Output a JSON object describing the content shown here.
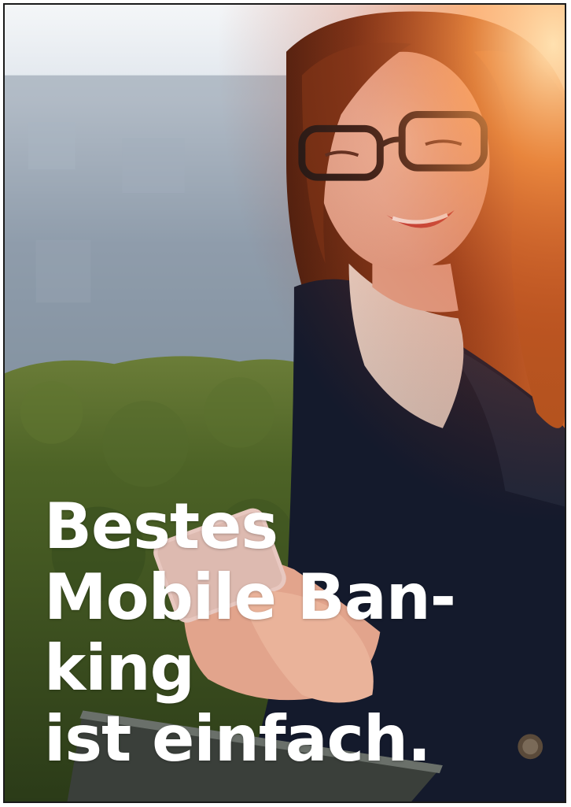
{
  "headline": {
    "lines": [
      "Bestes",
      "Mobile Ban-",
      "king",
      "ist einfach."
    ]
  },
  "photo": {
    "subject": "woman-with-glasses-using-smartphone",
    "colors": {
      "sky": "#eef2f6",
      "building": "#8796a6",
      "hedge": "#3f5a22",
      "coat": "#141a2c",
      "hair": "#7a3414",
      "flare": "#ff8a3a"
    }
  }
}
